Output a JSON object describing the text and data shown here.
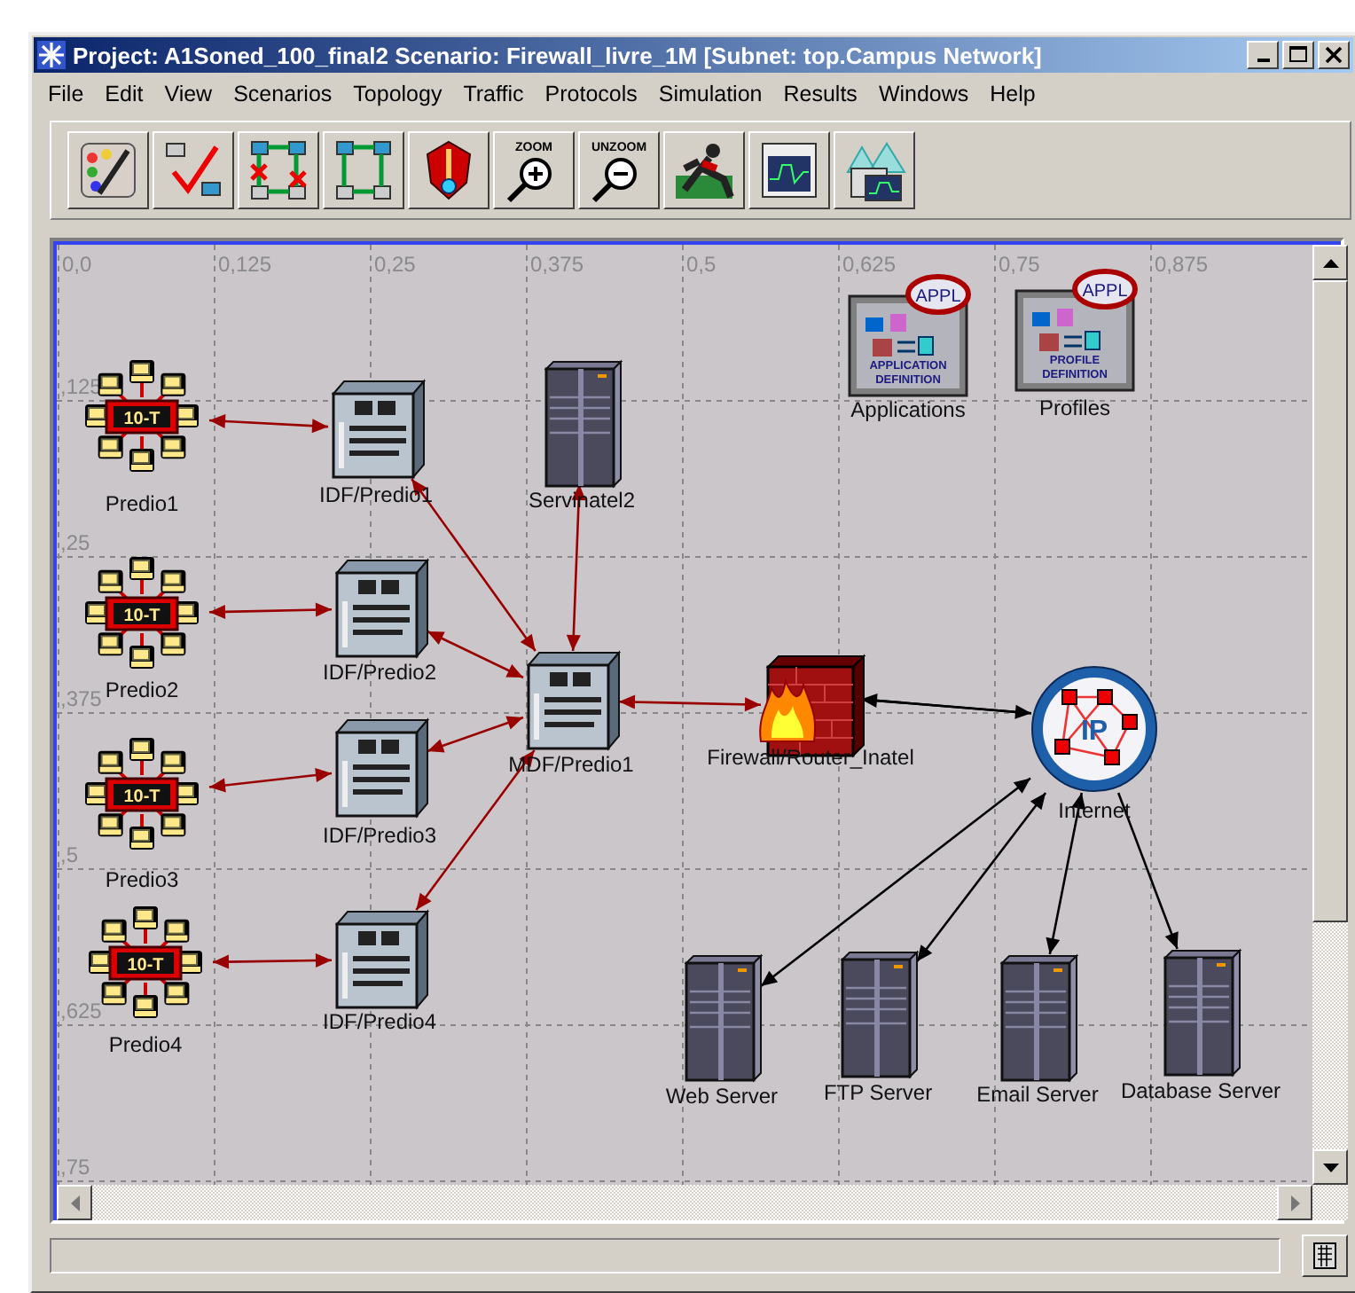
{
  "window": {
    "title": "Project: A1Soned_100_final2 Scenario: Firewall_livre_1M  [Subnet: top.Campus Network]"
  },
  "menu": [
    "File",
    "Edit",
    "View",
    "Scenarios",
    "Topology",
    "Traffic",
    "Protocols",
    "Simulation",
    "Results",
    "Windows",
    "Help"
  ],
  "toolbar": [
    {
      "kind": "palette"
    },
    {
      "kind": "check-links"
    },
    {
      "kind": "fail-links"
    },
    {
      "kind": "recover-links"
    },
    {
      "kind": "flag"
    },
    {
      "kind": "zoom",
      "label": "ZOOM"
    },
    {
      "kind": "unzoom",
      "label": "UNZOOM"
    },
    {
      "kind": "runner"
    },
    {
      "kind": "graph"
    },
    {
      "kind": "graphs"
    }
  ],
  "grid": {
    "x_labels": [
      "0,0",
      "0,125",
      "0,25",
      "0,375",
      "0,5",
      "0,625",
      "0,75",
      "0,875"
    ],
    "y_labels": [
      ",125",
      ",25",
      ",375",
      ",5",
      ",625",
      ",75"
    ]
  },
  "nodes": [
    {
      "kind": "hub",
      "label": "Predio1",
      "icon_text": "10-T"
    },
    {
      "kind": "hub",
      "label": "Predio2",
      "icon_text": "10-T"
    },
    {
      "kind": "hub",
      "label": "Predio3",
      "icon_text": "10-T"
    },
    {
      "kind": "hub",
      "label": "Predio4",
      "icon_text": "10-T"
    },
    {
      "kind": "switch",
      "label": "IDF/Predio1"
    },
    {
      "kind": "switch",
      "label": "IDF/Predio2"
    },
    {
      "kind": "switch",
      "label": "IDF/Predio3"
    },
    {
      "kind": "switch",
      "label": "IDF/Predio4"
    },
    {
      "kind": "server",
      "label": "Servinatel2"
    },
    {
      "kind": "switch",
      "label": "MDF/Predio1"
    },
    {
      "kind": "firewall",
      "label": "Firewall/Router_Inatel"
    },
    {
      "kind": "cloud",
      "label": "Internet",
      "icon_text": "IP"
    },
    {
      "kind": "config",
      "label": "Applications",
      "badge": "APPL",
      "icon_lines": [
        "APPLICATION",
        "DEFINITION"
      ]
    },
    {
      "kind": "config",
      "label": "Profiles",
      "badge": "APPL",
      "icon_lines": [
        "PROFILE",
        "DEFINITION"
      ]
    },
    {
      "kind": "server",
      "label": "Web Server"
    },
    {
      "kind": "server",
      "label": "FTP Server"
    },
    {
      "kind": "server",
      "label": "Email Server"
    },
    {
      "kind": "server",
      "label": "Database Server"
    }
  ],
  "links": [
    {
      "kind": "duplex",
      "color": "#990000"
    },
    {
      "kind": "duplex",
      "color": "#990000"
    },
    {
      "kind": "duplex",
      "color": "#990000"
    },
    {
      "kind": "duplex",
      "color": "#990000"
    },
    {
      "kind": "duplex",
      "color": "#990000"
    },
    {
      "kind": "duplex",
      "color": "#990000"
    },
    {
      "kind": "duplex",
      "color": "#990000"
    },
    {
      "kind": "duplex",
      "color": "#990000"
    },
    {
      "kind": "duplex",
      "color": "#990000"
    },
    {
      "kind": "duplex",
      "color": "#990000"
    },
    {
      "kind": "simplex",
      "color": "#000000"
    },
    {
      "kind": "simplex",
      "color": "#000000"
    },
    {
      "kind": "duplex",
      "color": "#000000"
    },
    {
      "kind": "duplex",
      "color": "#000000"
    },
    {
      "kind": "duplex",
      "color": "#000000"
    },
    {
      "kind": "simplex",
      "color": "#000000"
    }
  ]
}
